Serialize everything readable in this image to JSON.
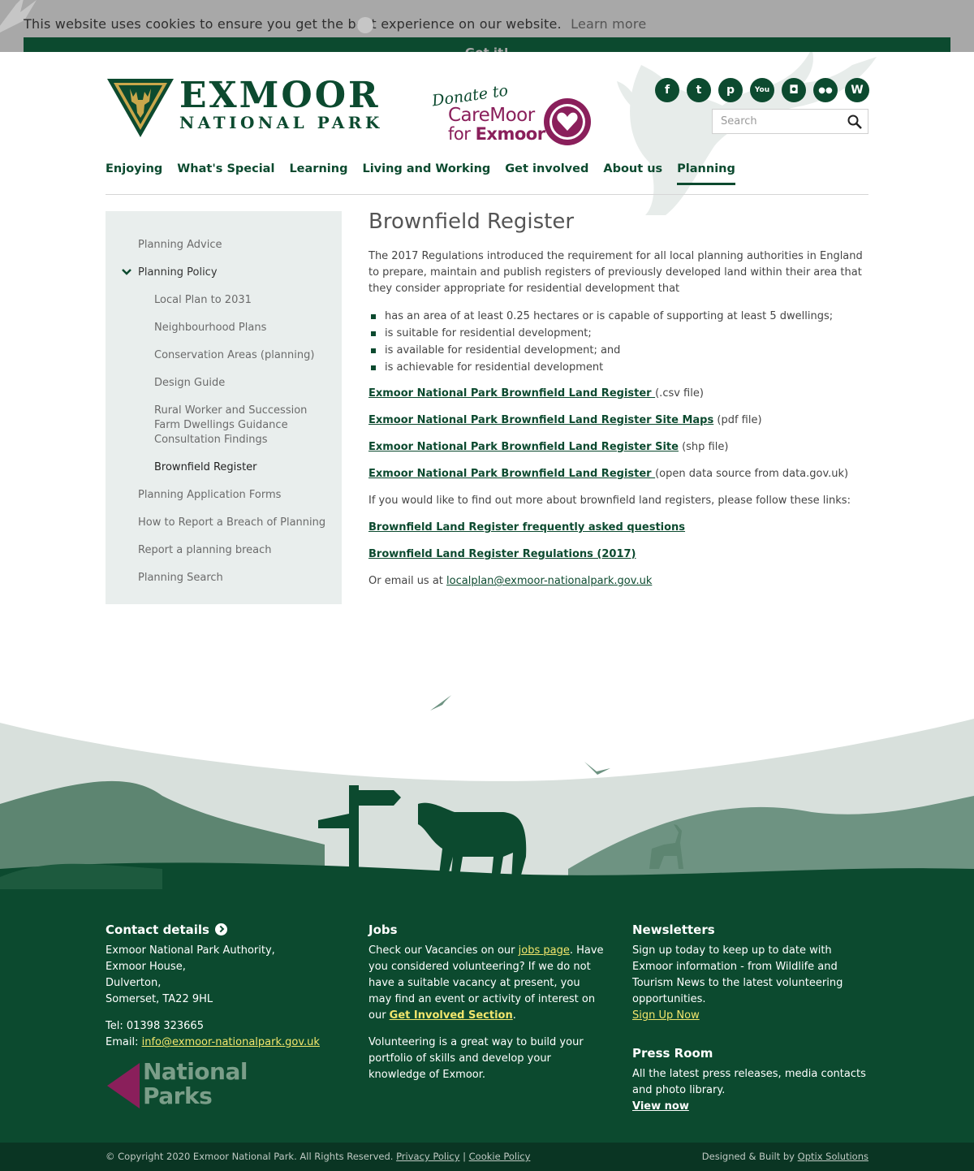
{
  "cookie": {
    "message": "This website uses cookies to ensure you get the best experience on our website.",
    "learn_more": "Learn more",
    "button": "Got it!"
  },
  "header": {
    "logo_title": "EXMOOR",
    "logo_subtitle": "NATIONAL PARK",
    "donate_line1": "Donate to",
    "donate_line2": "CareMoor",
    "donate_line3_a": "for",
    "donate_line3_b": "Exmoor",
    "social_icons": [
      "facebook-icon",
      "twitter-icon",
      "pinterest-icon",
      "youtube-icon",
      "instagram-icon",
      "flickr-icon",
      "wordpress-icon"
    ],
    "search_placeholder": "Search"
  },
  "nav": {
    "items": [
      "Enjoying",
      "What's Special",
      "Learning",
      "Living and Working",
      "Get involved",
      "About us",
      "Planning"
    ],
    "active": "Planning"
  },
  "sidebar": {
    "items": [
      {
        "label": "Planning Advice",
        "level": 1
      },
      {
        "label": "Planning Policy",
        "level": 1,
        "open": true
      },
      {
        "label": "Local Plan to 2031",
        "level": 2
      },
      {
        "label": "Neighbourhood Plans",
        "level": 2
      },
      {
        "label": "Conservation Areas (planning)",
        "level": 2
      },
      {
        "label": "Design Guide",
        "level": 2
      },
      {
        "label": "Rural Worker and Succession Farm Dwellings Guidance Consultation Findings",
        "level": 2
      },
      {
        "label": "Brownfield Register",
        "level": 2,
        "current": true
      },
      {
        "label": "Planning Application Forms",
        "level": 1
      },
      {
        "label": "How to Report a Breach of Planning",
        "level": 1
      },
      {
        "label": "Report a planning breach",
        "level": 1
      },
      {
        "label": "Planning Search",
        "level": 1
      }
    ]
  },
  "main": {
    "title": "Brownfield Register",
    "intro": "The 2017 Regulations introduced the requirement for all local planning authorities in England to prepare, maintain and publish registers of previously developed land within their area that they consider appropriate for residential development that",
    "bullets": [
      "has an area of at least 0.25 hectares or is capable of supporting at least 5 dwellings;",
      "is suitable for residential development;",
      "is available for residential development; and",
      "is achievable for residential development"
    ],
    "links": [
      {
        "text": "Exmoor National Park Brownfield Land Register ",
        "suffix": "(.csv file)"
      },
      {
        "text": "Exmoor National Park Brownfield Land Register Site Maps",
        "suffix": " (pdf file)"
      },
      {
        "text": "Exmoor National Park Brownfield Land Register Site",
        "suffix": " (shp file)"
      },
      {
        "text": "Exmoor National Park Brownfield Land Register ",
        "suffix": "(open data source from data.gov.uk)"
      }
    ],
    "more_text": "If you would like to find out more about brownfield land registers, please follow these links:",
    "faq_link": "Brownfield Land Register frequently asked questions",
    "regs_link": "Brownfield Land Register Regulations (2017)",
    "email_prefix": "Or email us at ",
    "email": "localplan@exmoor-nationalpark.gov.uk"
  },
  "footer": {
    "contact": {
      "heading": "Contact details",
      "address": [
        "Exmoor National Park Authority,",
        "Exmoor House,",
        "Dulverton,",
        "Somerset, TA22 9HL"
      ],
      "tel": "Tel: 01398 323665",
      "email_label": "Email: ",
      "email": "info@exmoor-nationalpark.gov.uk",
      "np_logo_line1": "National",
      "np_logo_line2": "Parks"
    },
    "jobs": {
      "heading": "Jobs",
      "p1_a": "Check our Vacancies on our ",
      "p1_link": "jobs page",
      "p1_b": ". Have you considered volunteering? If we do not have a suitable vacancy at present, you may find an event or activity of interest on our ",
      "p1_link2": "Get Involved Section",
      "p1_c": ".",
      "p2": "Volunteering is a great way to build your portfolio of skills and develop your knowledge of Exmoor."
    },
    "newsletters": {
      "heading": "Newsletters",
      "text": "Sign up today to keep up to date with Exmoor information - from Wildlife and Tourism News to the latest volunteering opportunities.",
      "link": "Sign Up Now"
    },
    "press": {
      "heading": "Press Room",
      "text": "All the latest press releases, media contacts and photo library.",
      "link": "View now"
    }
  },
  "bottom": {
    "copyright": "© Copyright 2020 Exmoor National Park. All Rights Reserved.",
    "privacy": "Privacy Policy",
    "separator": "|",
    "cookie": "Cookie Policy",
    "designed": "Designed & Built by ",
    "optix": "Optix Solutions"
  },
  "colors": {
    "brand_green": "#0c4a2f",
    "brand_magenta": "#8a1f5b",
    "link_yellow": "#f2e66c",
    "sidebar_bg": "#e9eeed"
  }
}
